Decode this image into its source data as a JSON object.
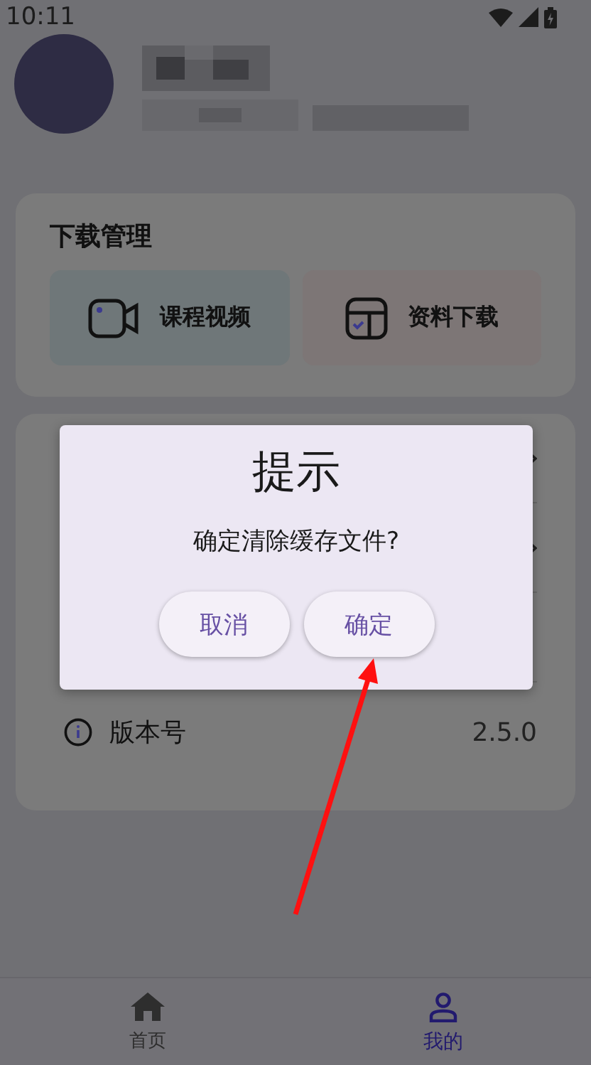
{
  "status_bar": {
    "time": "10:11"
  },
  "download_section": {
    "title": "下载管理",
    "tiles": [
      {
        "kind": "video",
        "label": "课程视频"
      },
      {
        "kind": "document",
        "label": "资料下载"
      }
    ]
  },
  "settings_rows": [
    {
      "kind": "chevron"
    },
    {
      "kind": "chevron"
    },
    {
      "kind": "blank"
    }
  ],
  "version_row": {
    "label": "版本号",
    "value": "2.5.0"
  },
  "dialog": {
    "title": "提示",
    "message": "确定清除缓存文件?",
    "buttons": [
      "取消",
      "确定"
    ]
  },
  "bottom_nav": [
    {
      "kind": "home",
      "label": "首页",
      "selected": false
    },
    {
      "kind": "person",
      "label": "我的",
      "selected": true
    }
  ]
}
